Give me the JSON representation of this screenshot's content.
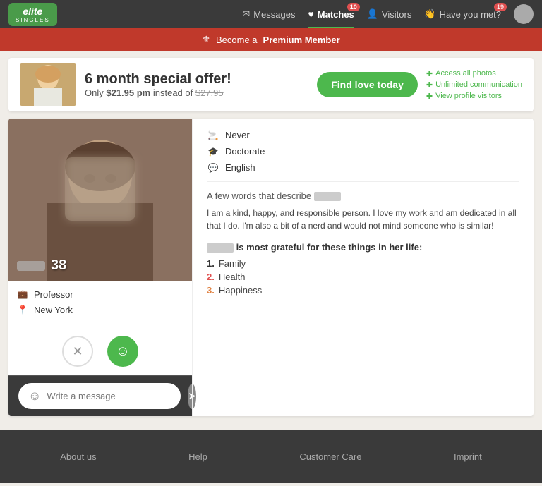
{
  "header": {
    "logo_elite": "elite",
    "logo_singles": "SINGLES",
    "nav": {
      "messages_label": "Messages",
      "matches_label": "Matches",
      "matches_badge": "10",
      "visitors_label": "Visitors",
      "have_you_met_label": "Have you met?",
      "have_you_met_badge": "19"
    }
  },
  "premium_banner": {
    "text_before": "Become a",
    "text_highlight": "Premium Member"
  },
  "offer": {
    "title": "6 month special offer!",
    "subtitle_before": "Only",
    "price": "$21.95 pm",
    "subtitle_after": "instead of",
    "old_price": "$27.95",
    "button_label": "Find love today",
    "features": [
      "Access all photos",
      "Unlimited communication",
      "View profile visitors"
    ]
  },
  "profile": {
    "age": "38",
    "name_blur": "",
    "occupation": "Professor",
    "location": "New York",
    "attributes": {
      "smoking": "Never",
      "education": "Doctorate",
      "language": "English"
    },
    "describe_title": "A few words that describe",
    "describe_text": "I am a kind, happy, and responsible person. I love my work and am dedicated in all that I do. I'm also a bit of a nerd and would not mind someone who is similar!",
    "grateful_title_prefix": "is most grateful for these things in her life:",
    "grateful_items": [
      {
        "num": "1.",
        "text": "Family",
        "color_class": "list-num-1"
      },
      {
        "num": "2.",
        "text": "Health",
        "color_class": "list-num-2"
      },
      {
        "num": "3.",
        "text": "Happiness",
        "color_class": "list-num-3"
      }
    ]
  },
  "message": {
    "placeholder": "Write a message"
  },
  "footer": {
    "links": [
      "About us",
      "Help",
      "Customer Care",
      "Imprint"
    ]
  },
  "colors": {
    "green": "#4db84d",
    "red": "#c0392b",
    "dark": "#3a3a3a"
  }
}
